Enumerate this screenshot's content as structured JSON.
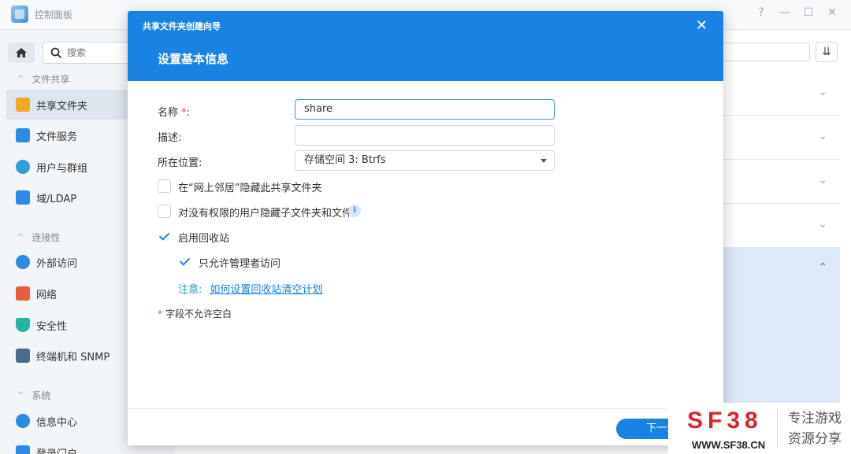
{
  "app": {
    "title": "控制面板"
  },
  "window_controls": {
    "help": "?",
    "minimize": "—",
    "maximize": "☐",
    "close": "✕"
  },
  "sidebar": {
    "search_placeholder": "搜索",
    "groups": [
      {
        "label": "文件共享",
        "collapse": "^"
      },
      {
        "label": "连接性",
        "collapse": "^"
      },
      {
        "label": "系统",
        "collapse": "^"
      }
    ],
    "items": [
      {
        "label": "共享文件夹",
        "icon": "shared-folder-icon",
        "color": "#f5a623"
      },
      {
        "label": "文件服务",
        "icon": "file-services-icon",
        "color": "#2b8ae6"
      },
      {
        "label": "用户与群组",
        "icon": "users-icon",
        "color": "#2f9fe0"
      },
      {
        "label": "域/LDAP",
        "icon": "ldap-icon",
        "color": "#2b8ae6"
      },
      {
        "label": "外部访问",
        "icon": "external-access-icon",
        "color": "#2b8ae6"
      },
      {
        "label": "网络",
        "icon": "network-icon",
        "color": "#e85d3c"
      },
      {
        "label": "安全性",
        "icon": "security-icon",
        "color": "#26b3a1"
      },
      {
        "label": "终端机和 SNMP",
        "icon": "terminal-icon",
        "color": "#4a6b8a"
      },
      {
        "label": "信息中心",
        "icon": "info-center-icon",
        "color": "#2b8ae6"
      },
      {
        "label": "登录门户",
        "icon": "login-portal-icon",
        "color": "#2b8ae6"
      }
    ]
  },
  "modal": {
    "window_title": "共享文件夹创建向导",
    "close": "✕",
    "step_title": "设置基本信息",
    "fields": {
      "name_label": "名称",
      "name_required": "*",
      "name_colon": ":",
      "name_value": "share",
      "desc_label": "描述:",
      "desc_value": "",
      "location_label": "所在位置:",
      "location_value": "存储空间 3:  Btrfs"
    },
    "checkboxes": {
      "hide_network": {
        "label": "在“网上邻居”隐藏此共享文件夹",
        "checked": false
      },
      "hide_subfolders": {
        "label": "对没有权限的用户隐藏子文件夹和文件",
        "checked": false
      },
      "recycle_bin": {
        "label": "启用回收站",
        "checked": true
      },
      "admin_only": {
        "label": "只允许管理者访问",
        "checked": true
      }
    },
    "info_glyph": "i",
    "note_label": "注意:",
    "note_link": "如何设置回收站清空计划",
    "required_mark": "*",
    "required_note": "字段不允许空白",
    "next_button": "下一步"
  },
  "watermark": {
    "logo": "SF38",
    "url": "WWW.SF38.CN",
    "slogan_line1": "专注游戏",
    "slogan_line2": "资源分享"
  }
}
